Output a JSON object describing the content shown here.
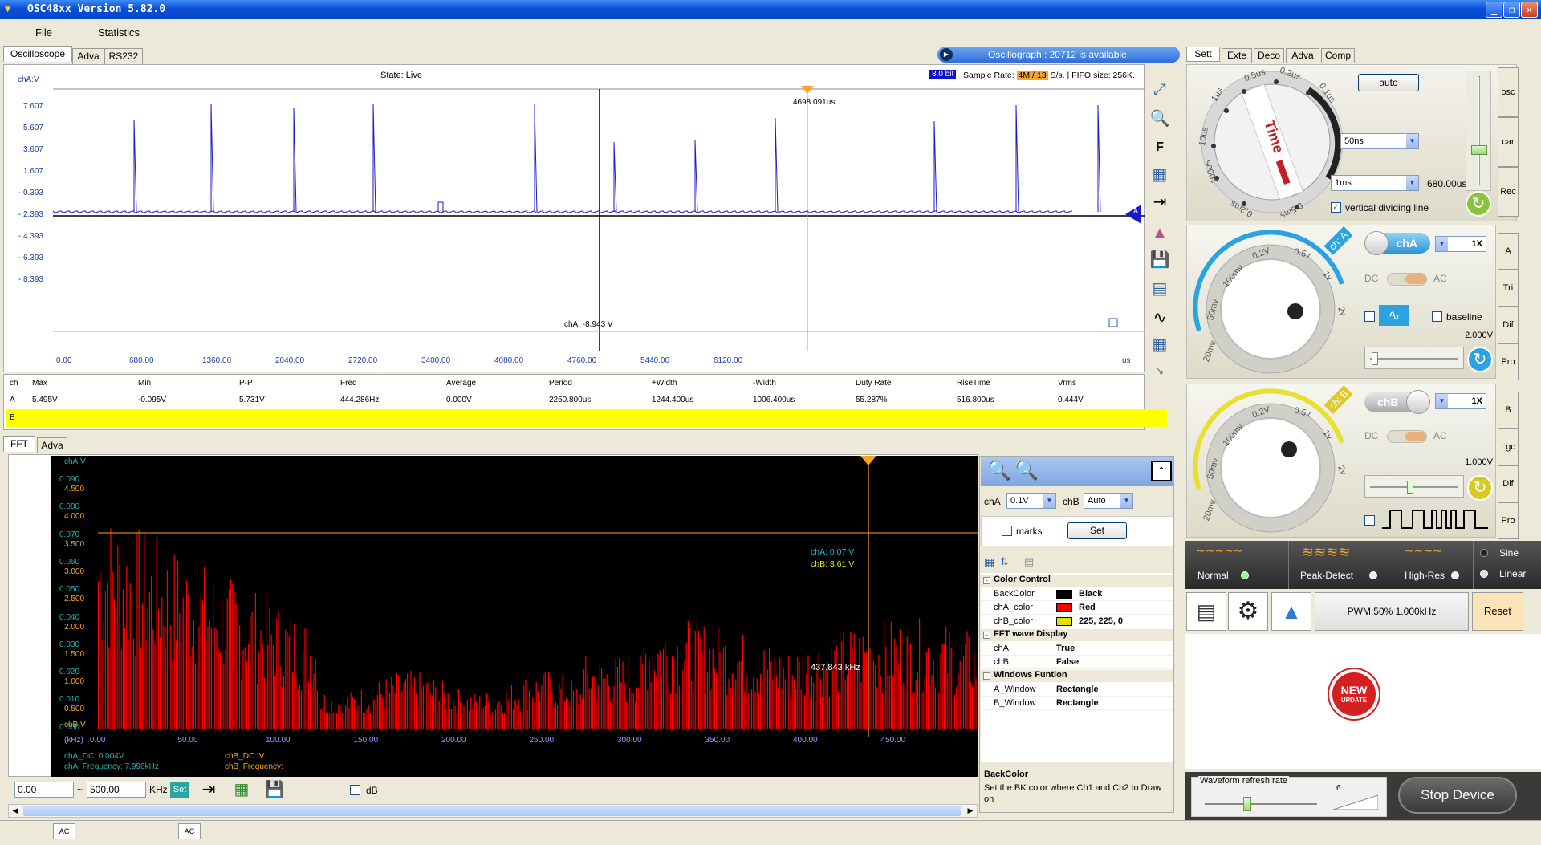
{
  "app": {
    "title": "OSC48xx  Version 5.82.0"
  },
  "menu": {
    "file": "File",
    "statistics": "Statistics"
  },
  "top_tabs": [
    "Oscilloscope",
    "Adva",
    "RS232"
  ],
  "banner": "Oscillograph : 20712 is available.",
  "osc": {
    "channel_label": "chA:V",
    "state": "State: Live",
    "bits": "8.0 bit",
    "sample_rate_label": "Sample Rate:",
    "sample_rate_value": "4M / 13",
    "sample_rate_unit": "S/s.",
    "fifo": "| FIFO size: 256K.",
    "cursor_time": "4698.091us",
    "cursor_voltage": "chA: -8.943 V",
    "marker_a": "A",
    "x_unit": "us",
    "y_ticks": [
      "7.607",
      "5.607",
      "3.607",
      "1.607",
      "- 0.393",
      "- 2.393",
      "- 4.393",
      "- 6.393",
      "- 8.393"
    ],
    "x_ticks": [
      "0.00",
      "680.00",
      "1360.00",
      "2040.00",
      "2720.00",
      "3400.00",
      "4080.00",
      "4760.00",
      "5440.00",
      "6120.00"
    ]
  },
  "measure": {
    "headers": [
      "ch",
      "Max",
      "Min",
      "P-P",
      "Freq",
      "Average",
      "Period",
      "+Width",
      "-Width",
      "Duty Rate",
      "RiseTime",
      "Vrms"
    ],
    "row_a": [
      "A",
      "5.495V",
      "-0.095V",
      "5.731V",
      "444.286Hz",
      "0.000V",
      "2250.800us",
      "1244.400us",
      "1006.400us",
      "55.287%",
      "516.800us",
      "0.444V"
    ],
    "row_b": "B"
  },
  "fft_tabs": [
    "FFT",
    "Adva"
  ],
  "fft": {
    "cha_label": "chA:V",
    "chb_label": "chB:V",
    "cha_ticks": [
      "0.090",
      "0.080",
      "0.070",
      "0.060",
      "0.050",
      "0.040",
      "0.030",
      "0.020",
      "0.010",
      "0.000"
    ],
    "chb_ticks": [
      "4.500",
      "4.000",
      "3.500",
      "3.000",
      "2.500",
      "2.000",
      "1.500",
      "1.000",
      "0.500"
    ],
    "x_unit": "(kHz)",
    "x_ticks": [
      "0.00",
      "50.00",
      "100.00",
      "150.00",
      "200.00",
      "250.00",
      "300.00",
      "350.00",
      "400.00",
      "450.00"
    ],
    "cursor_cha": "chA: 0.07 V",
    "cursor_chb": "chB: 3.61 V",
    "cursor_freq": "437.843 kHz",
    "cha_dc": "chA_DC: 0.004V",
    "cha_freq": "chA_Frequency: 7.996kHz",
    "chb_dc": "chB_DC: V",
    "chb_freq": "chB_Frequency:",
    "range_from": "0.00",
    "range_sep": "~",
    "range_to": "500.00",
    "range_unit": "KHz",
    "set_label": "Set",
    "db_label": "dB"
  },
  "fft_props": {
    "cha_label": "chA",
    "cha_value": "0.1V",
    "chb_label": "chB",
    "chb_value": "Auto",
    "marks_label": "marks",
    "set_label": "Set",
    "cat_color": "Color Control",
    "color_rows": [
      [
        "BackColor",
        "Black"
      ],
      [
        "chA_color",
        "Red"
      ],
      [
        "chB_color",
        "225, 225, 0"
      ]
    ],
    "color_swatches": [
      "#000000",
      "#ff0000",
      "#e1e100"
    ],
    "cat_wave": "FFT wave Display",
    "wave_rows": [
      [
        "chA",
        "True"
      ],
      [
        "chB",
        "False"
      ]
    ],
    "cat_win": "Windows Funtion",
    "win_rows": [
      [
        "A_Window",
        "Rectangle"
      ],
      [
        "B_Window",
        "Rectangle"
      ]
    ],
    "desc_title": "BackColor",
    "desc_text": "Set the BK color where Ch1 and Ch2 to Draw on"
  },
  "right_tabs": [
    "Sett",
    "Exte",
    "Deco",
    "Adva",
    "Comp"
  ],
  "timebase": {
    "auto": "auto",
    "dial_label": "Time",
    "dial_marks": [
      "1us",
      "0.5us",
      "0.2us",
      "0.1us",
      "10us",
      "100us",
      "0.2ms",
      "0.5ms"
    ],
    "combo1": "50ns",
    "combo2": "1ms",
    "value": "680.00us",
    "vline": "vertical dividing line"
  },
  "side_tabs_top": [
    "osc",
    "car",
    "Rec"
  ],
  "cha": {
    "tag": "ch: A",
    "toggle": "chA",
    "mult": "1X",
    "dc": "DC",
    "ac": "AC",
    "baseline": "baseline",
    "volt": "2.000V",
    "marks": [
      "20mv",
      "50mv",
      "100mv",
      "0.2V",
      "0.5v",
      "1v",
      "2v"
    ]
  },
  "chb": {
    "tag": "ch: B",
    "toggle": "chB",
    "mult": "1X",
    "dc": "DC",
    "ac": "AC",
    "volt": "1.000V",
    "marks": [
      "20mv",
      "50mv",
      "100mv",
      "0.2V",
      "0.5v",
      "1v",
      "2v"
    ]
  },
  "side_tabs_a": [
    "A",
    "Tri",
    "Dif",
    "Pro"
  ],
  "side_tabs_b": [
    "B",
    "Lgc",
    "Dif",
    "Pro"
  ],
  "modes": {
    "normal": "Normal",
    "peak": "Peak-Detect",
    "highres": "High-Res",
    "sine": "Sine",
    "linear": "Linear"
  },
  "tools": {
    "pwm": "PWM:50% 1.000kHz",
    "reset": "Reset"
  },
  "badge": {
    "line1": "NEW",
    "line2": "UPDATE"
  },
  "refresh": {
    "label": "Waveform refresh rate",
    "value": "6"
  },
  "stop": "Stop Device",
  "status": {
    "a": "AC",
    "b": "AC"
  },
  "colors": {
    "trace_a": "#1a1acc",
    "fft_red": "#ff0000",
    "chb_yellow": "#e8e800",
    "cursor_orange": "#f5a623",
    "title_blue": "#0a4fd8"
  }
}
